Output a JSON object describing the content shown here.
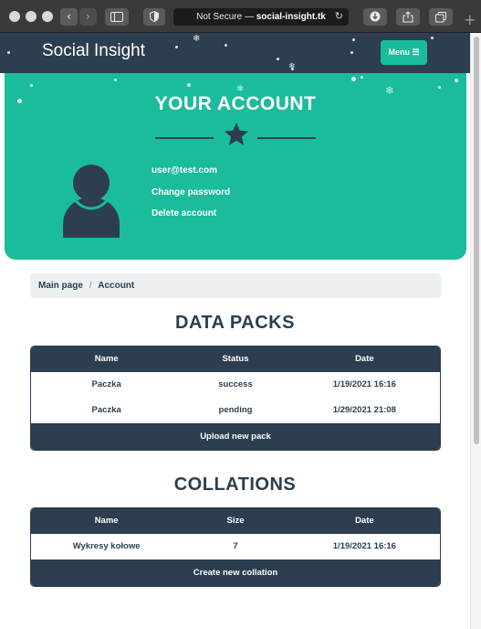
{
  "browser": {
    "url_prefix": "Not Secure —",
    "url_host": "social-insight.tk",
    "back_glyph": "‹",
    "forward_glyph": "›",
    "new_tab_glyph": "+",
    "reload_glyph": "↻"
  },
  "navbar": {
    "brand": "Social Insight",
    "menu_label": "Menu ☰"
  },
  "hero": {
    "title": "YOUR ACCOUNT",
    "email": "user@test.com",
    "change_password": "Change password",
    "delete_account": "Delete account"
  },
  "breadcrumb": {
    "home": "Main page",
    "separator": "/",
    "current": "Account"
  },
  "data_packs": {
    "title": "DATA PACKS",
    "columns": [
      "Name",
      "Status",
      "Date"
    ],
    "rows": [
      {
        "name": "Paczka",
        "status": "success",
        "date": "1/19/2021 16:16"
      },
      {
        "name": "Paczka",
        "status": "pending",
        "date": "1/29/2021 21:08"
      }
    ],
    "footer": "Upload new pack"
  },
  "collations": {
    "title": "COLLATIONS",
    "columns": [
      "Name",
      "Size",
      "Date"
    ],
    "rows": [
      {
        "name": "Wykresy kołowe",
        "size": "7",
        "date": "1/19/2021 16:16"
      }
    ],
    "footer": "Create new collation"
  },
  "colors": {
    "primary": "#2c3e50",
    "accent": "#1abc9c",
    "light": "#ecf0f1"
  }
}
